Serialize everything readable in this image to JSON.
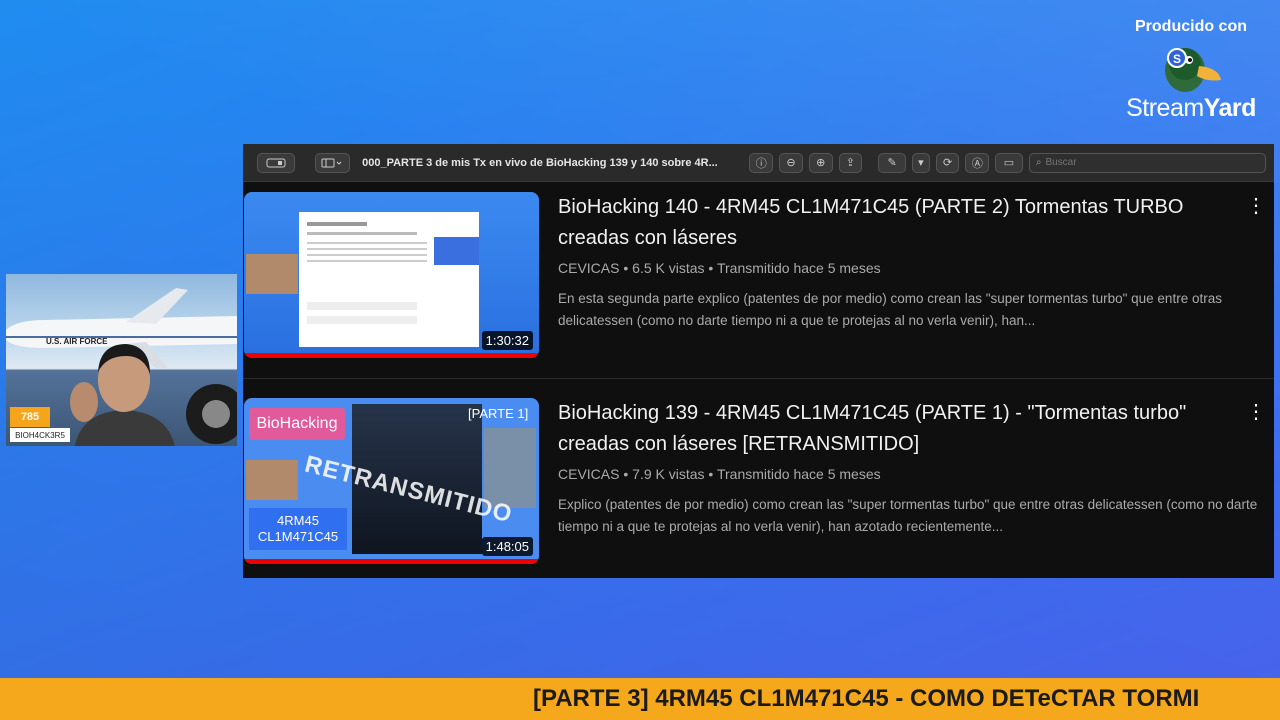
{
  "branding": {
    "produced_label": "Producido con",
    "logo_icon": "streamyard-duck-icon",
    "name_part1": "Stream",
    "name_part2": "Yard"
  },
  "webcam": {
    "score": "785",
    "username": "BIOH4CK3R5",
    "plane_text": "U.S. AIR FORCE"
  },
  "toolbar": {
    "title": "000_PARTE 3 de mis Tx en vivo de BioHacking 139 y 140 sobre 4R...",
    "search_placeholder": "Buscar"
  },
  "videos": [
    {
      "title": "BioHacking 140 - 4RM45 CL1M471C45 (PARTE 2) Tormentas TURBO creadas con láseres",
      "channel": "CEVICAS",
      "views": "6.5 K vistas",
      "time": "Transmitido hace 5 meses",
      "description": "En esta segunda parte explico (patentes de por medio) como crean las \"super tormentas turbo\" que entre otras delicatessen (como no darte tiempo ni a que te protejas al no verla venir), han...",
      "duration": "1:30:32"
    },
    {
      "title": "BioHacking 139 - 4RM45 CL1M471C45 (PARTE 1) - \"Tormentas turbo\" creadas con láseres [RETRANSMITIDO]",
      "channel": "CEVICAS",
      "views": "7.9 K vistas",
      "time": "Transmitido hace 5 meses",
      "description": "Explico (patentes de por medio) como crean las \"super tormentas turbo\" que entre otras delicatessen (como no darte tiempo ni a que te protejas al no verla venir), han azotado recientemente...",
      "duration": "1:48:05",
      "thumb_badge": "BioHacking",
      "thumb_code": "4RM45 CL1M471C45",
      "thumb_stamp": "RETRANSMITIDO",
      "thumb_parte": "[PARTE 1]"
    }
  ],
  "ticker": {
    "text": "[PARTE 3] 4RM45 CL1M471C45 - COMO DETeCTAR TORMI"
  },
  "colors": {
    "ticker_bg": "#f6a81d",
    "screen_bg": "#0f0f0f",
    "progress_red": "#ee0000"
  }
}
